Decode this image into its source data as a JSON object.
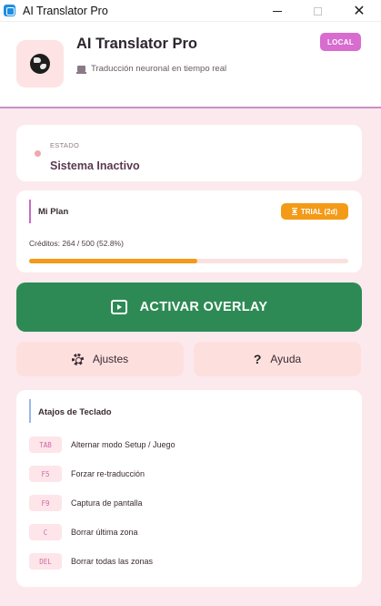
{
  "window": {
    "title": "AI Translator Pro"
  },
  "header": {
    "app_name": "AI Translator Pro",
    "subtitle": "Traducción neuronal en tiempo real",
    "badge": "LOCAL",
    "logo_icon": "globe-icon"
  },
  "status": {
    "label": "ESTADO",
    "value": "Sistema Inactivo",
    "dot_color": "#f2a7b0"
  },
  "plan": {
    "title": "Mi Plan",
    "badge": "TRIAL (2d)",
    "credits_text": "Créditos: 264 / 500 (52.8%)",
    "credits_used": 264,
    "credits_total": 500,
    "progress_percent": 52.8,
    "accent_color": "#f39a17"
  },
  "actions": {
    "overlay_label": "ACTIVAR OVERLAY",
    "settings_label": "Ajustes",
    "help_label": "Ayuda"
  },
  "shortcuts": {
    "title": "Atajos de Teclado",
    "items": [
      {
        "key": "TAB",
        "desc": "Alternar modo Setup / Juego"
      },
      {
        "key": "F5",
        "desc": "Forzar re-traducción"
      },
      {
        "key": "F9",
        "desc": "Captura de pantalla"
      },
      {
        "key": "C",
        "desc": "Borrar última zona"
      },
      {
        "key": "DEL",
        "desc": "Borrar todas las zonas"
      }
    ]
  },
  "colors": {
    "background": "#fce9ee",
    "primary_green": "#2e8a55",
    "badge_pink": "#d86ccf",
    "trial_orange": "#f39a17"
  }
}
